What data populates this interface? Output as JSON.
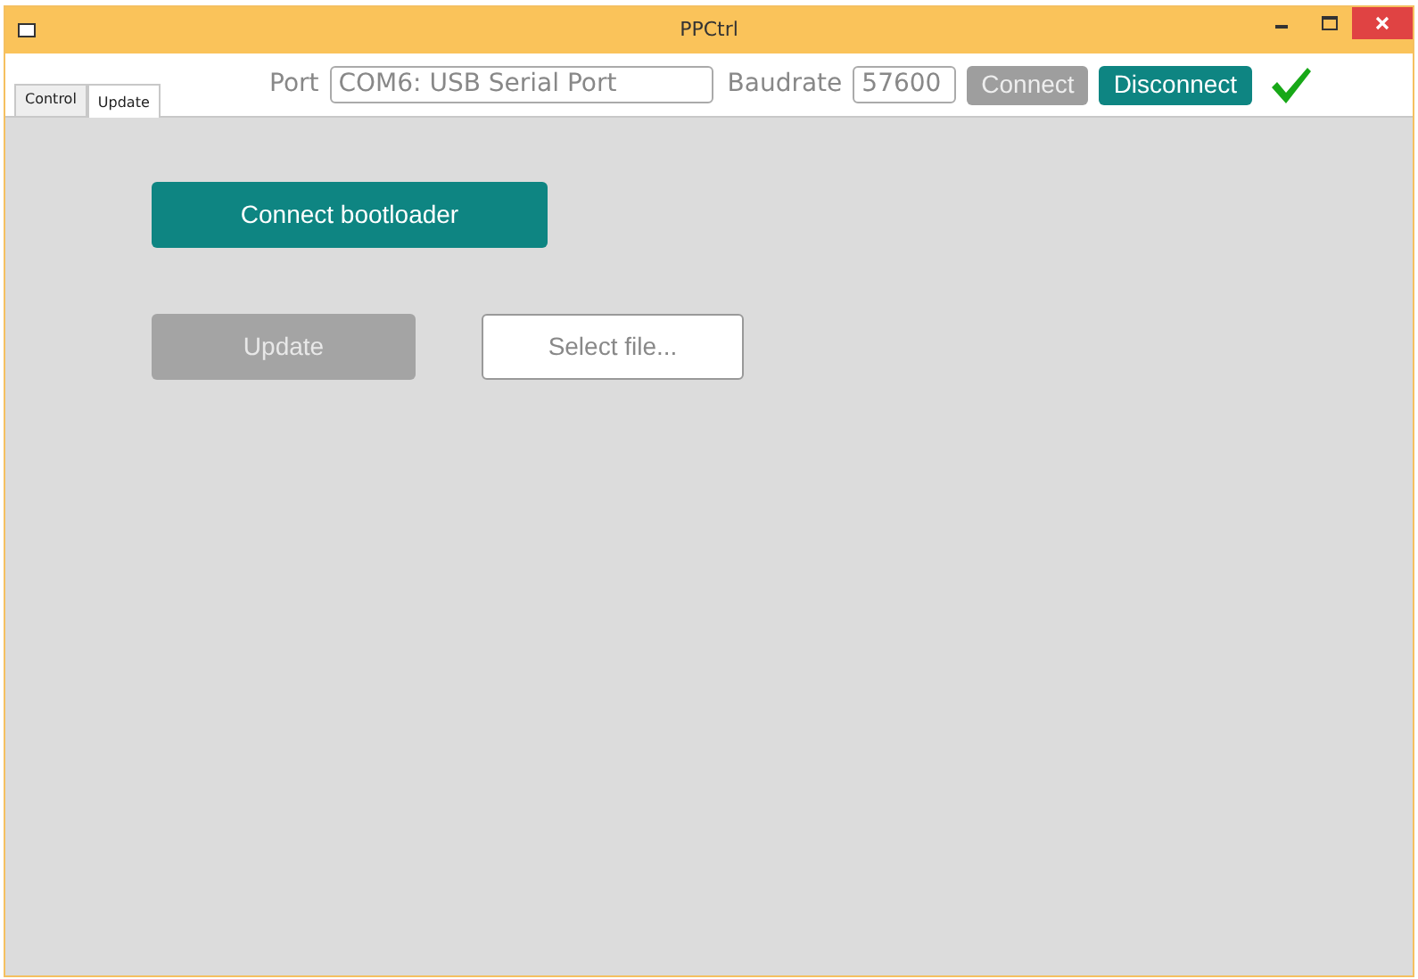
{
  "window": {
    "title": "PPCtrl"
  },
  "tabs": [
    {
      "label": "Control",
      "selected": false
    },
    {
      "label": "Update",
      "selected": true
    }
  ],
  "connection": {
    "port_label": "Port",
    "port_value": "COM6: USB Serial Port",
    "baud_label": "Baudrate",
    "baud_value": "57600",
    "connected": true,
    "buttons": [
      {
        "label": "Connect",
        "disabled": true
      },
      {
        "label": "Disconnect",
        "disabled": false
      }
    ]
  },
  "update_panel": {
    "buttons": [
      {
        "label": "Connect bootloader",
        "kind": "primary",
        "disabled": false
      },
      {
        "label": "Update",
        "kind": "primary",
        "disabled": true
      },
      {
        "label": "Select file...",
        "kind": "outline",
        "disabled": false
      }
    ]
  }
}
